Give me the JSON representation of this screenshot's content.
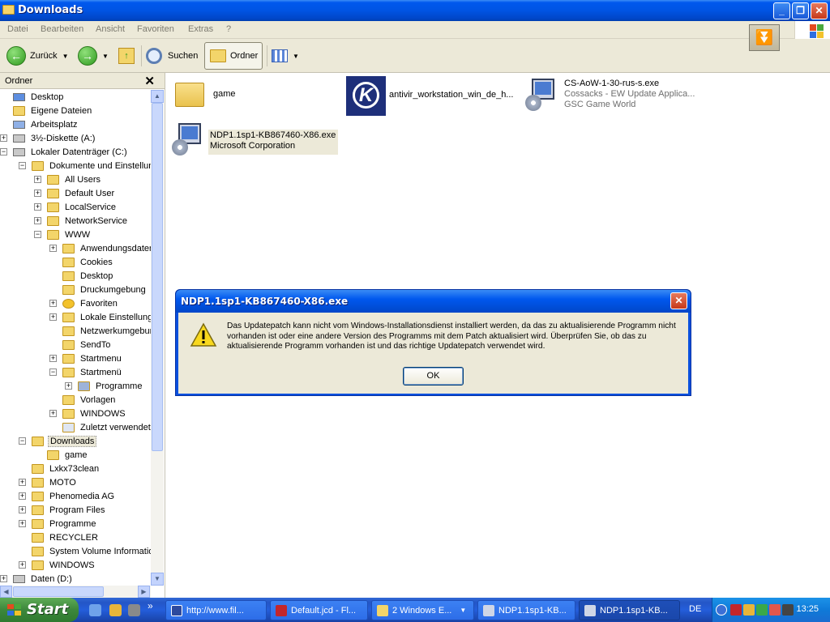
{
  "window": {
    "title": "Downloads"
  },
  "menu": [
    "Datei",
    "Bearbeiten",
    "Ansicht",
    "Favoriten",
    "Extras",
    "?"
  ],
  "toolbar": {
    "back": "Zurück",
    "search": "Suchen",
    "folders": "Ordner"
  },
  "panel": {
    "title": "Ordner"
  },
  "tree": [
    {
      "label": "Desktop",
      "level": 0,
      "exp": "",
      "icon": "desktop"
    },
    {
      "label": "Eigene Dateien",
      "level": 0,
      "exp": "",
      "icon": "folder"
    },
    {
      "label": "Arbeitsplatz",
      "level": 0,
      "exp": "",
      "icon": "computer"
    },
    {
      "label": "3½-Diskette (A:)",
      "level": 0,
      "exp": "+",
      "icon": "drive"
    },
    {
      "label": "Lokaler Datenträger (C:)",
      "level": 0,
      "exp": "-",
      "icon": "drive"
    },
    {
      "label": "Dokumente und Einstellungen",
      "level": 1,
      "exp": "-",
      "icon": "folder"
    },
    {
      "label": "All Users",
      "level": 2,
      "exp": "+",
      "icon": "folder"
    },
    {
      "label": "Default User",
      "level": 2,
      "exp": "+",
      "icon": "folder"
    },
    {
      "label": "LocalService",
      "level": 2,
      "exp": "+",
      "icon": "folder"
    },
    {
      "label": "NetworkService",
      "level": 2,
      "exp": "+",
      "icon": "folder"
    },
    {
      "label": "WWW",
      "level": 2,
      "exp": "-",
      "icon": "folder"
    },
    {
      "label": "Anwendungsdaten",
      "level": 3,
      "exp": "+",
      "icon": "folder"
    },
    {
      "label": "Cookies",
      "level": 3,
      "exp": "",
      "icon": "folder"
    },
    {
      "label": "Desktop",
      "level": 3,
      "exp": "",
      "icon": "folder"
    },
    {
      "label": "Druckumgebung",
      "level": 3,
      "exp": "",
      "icon": "folder"
    },
    {
      "label": "Favoriten",
      "level": 3,
      "exp": "+",
      "icon": "star"
    },
    {
      "label": "Lokale Einstellungen",
      "level": 3,
      "exp": "+",
      "icon": "folder"
    },
    {
      "label": "Netzwerkumgebung",
      "level": 3,
      "exp": "",
      "icon": "folder"
    },
    {
      "label": "SendTo",
      "level": 3,
      "exp": "",
      "icon": "folder"
    },
    {
      "label": "Startmenu",
      "level": 3,
      "exp": "+",
      "icon": "folder"
    },
    {
      "label": "Startmenü",
      "level": 3,
      "exp": "-",
      "icon": "folder"
    },
    {
      "label": "Programme",
      "level": 4,
      "exp": "+",
      "icon": "programs"
    },
    {
      "label": "Vorlagen",
      "level": 3,
      "exp": "",
      "icon": "folder"
    },
    {
      "label": "WINDOWS",
      "level": 3,
      "exp": "+",
      "icon": "folder"
    },
    {
      "label": "Zuletzt verwendete",
      "level": 3,
      "exp": "",
      "icon": "recent"
    },
    {
      "label": "Downloads",
      "level": 1,
      "exp": "-",
      "icon": "folder",
      "selected": true
    },
    {
      "label": "game",
      "level": 2,
      "exp": "",
      "icon": "folder"
    },
    {
      "label": "Lxkx73clean",
      "level": 1,
      "exp": "",
      "icon": "folder"
    },
    {
      "label": "MOTO",
      "level": 1,
      "exp": "+",
      "icon": "folder"
    },
    {
      "label": "Phenomedia AG",
      "level": 1,
      "exp": "+",
      "icon": "folder"
    },
    {
      "label": "Program Files",
      "level": 1,
      "exp": "+",
      "icon": "folder"
    },
    {
      "label": "Programme",
      "level": 1,
      "exp": "+",
      "icon": "folder"
    },
    {
      "label": "RECYCLER",
      "level": 1,
      "exp": "",
      "icon": "folder"
    },
    {
      "label": "System Volume Information",
      "level": 1,
      "exp": "",
      "icon": "folder"
    },
    {
      "label": "WINDOWS",
      "level": 1,
      "exp": "+",
      "icon": "folder"
    },
    {
      "label": "Daten (D:)",
      "level": 0,
      "exp": "+",
      "icon": "drive"
    }
  ],
  "files": [
    {
      "name": "game",
      "sub1": "",
      "sub2": "",
      "icon": "folder-large"
    },
    {
      "name": "antivir_workstation_win_de_h...",
      "sub1": "",
      "sub2": "",
      "icon": "avira-icon"
    },
    {
      "name": "CS-AoW-1-30-rus-s.exe",
      "sub1": "Cossacks - EW Update Applica...",
      "sub2": "GSC Game World",
      "icon": "installer-icon"
    },
    {
      "name": "NDP1.1sp1-KB867460-X86.exe",
      "sub1": "Microsoft Corporation",
      "sub2": "",
      "icon": "installer-icon"
    }
  ],
  "dialog": {
    "title": "NDP1.1sp1-KB867460-X86.exe",
    "message": "Das Updatepatch kann nicht vom Windows-Installationsdienst installiert werden, da das zu aktualisierende Programm nicht vorhanden ist oder eine andere Version des Programms mit dem Patch aktualisiert wird. Überprüfen Sie, ob das zu aktualisierende Programm vorhanden ist und das richtige Updatepatch verwendet wird.",
    "ok": "OK"
  },
  "taskbar": {
    "start": "Start",
    "tasks": [
      {
        "label": "http://www.fil...",
        "active": false
      },
      {
        "label": "Default.jcd - Fl...",
        "active": false
      },
      {
        "label": "2 Windows E...",
        "active": false
      },
      {
        "label": "NDP1.1sp1-KB...",
        "active": false
      },
      {
        "label": "NDP1.1sp1-KB...",
        "active": true
      }
    ],
    "lang": "DE",
    "clock": "13:25"
  }
}
